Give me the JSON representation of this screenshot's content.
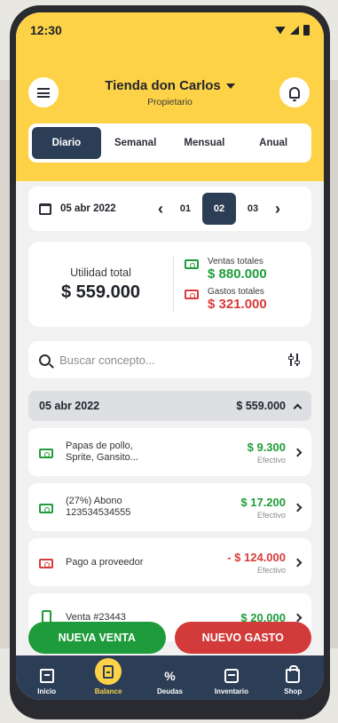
{
  "status": {
    "time": "12:30"
  },
  "header": {
    "store_name": "Tienda don Carlos",
    "role": "Propietario"
  },
  "tabs": [
    {
      "label": "Diario",
      "active": true
    },
    {
      "label": "Semanal",
      "active": false
    },
    {
      "label": "Mensual",
      "active": false
    },
    {
      "label": "Anual",
      "active": false
    }
  ],
  "date_picker": {
    "date": "05 abr 2022",
    "days": [
      "01",
      "02",
      "03"
    ],
    "selected_day": "02"
  },
  "summary": {
    "profit_label": "Utilidad total",
    "profit_value": "$ 559.000",
    "sales_label": "Ventas totales",
    "sales_value": "$ 880.000",
    "expenses_label": "Gastos totales",
    "expenses_value": "$ 321.000"
  },
  "search": {
    "placeholder": "Buscar concepto..."
  },
  "group": {
    "date": "05 abr 2022",
    "total": "$ 559.000"
  },
  "transactions": [
    {
      "desc_line1": "Papas de pollo,",
      "desc_line2": "Sprite, Gansito...",
      "amount": "$ 9.300",
      "method": "Efectivo",
      "type": "income"
    },
    {
      "desc_line1": "(27%) Abono",
      "desc_line2": "123534534555",
      "amount": "$ 17.200",
      "method": "Efectivo",
      "type": "income"
    },
    {
      "desc_line1": "Pago a proveedor",
      "desc_line2": "",
      "amount": "- $ 124.000",
      "method": "Efectivo",
      "type": "expense"
    },
    {
      "desc_line1": "Venta #23443",
      "desc_line2": "",
      "amount": "$ 20.000",
      "method": "",
      "type": "income"
    }
  ],
  "actions": {
    "new_sale": "NUEVA VENTA",
    "new_expense": "NUEVO GASTO"
  },
  "nav": [
    {
      "label": "Inicio",
      "icon": "home-icon"
    },
    {
      "label": "Balance",
      "icon": "balance-icon"
    },
    {
      "label": "Deudas",
      "icon": "percent-icon"
    },
    {
      "label": "Inventario",
      "icon": "inventory-icon"
    },
    {
      "label": "Shop",
      "icon": "shop-icon"
    }
  ],
  "colors": {
    "yellow": "#fdd247",
    "navy": "#2c3e56",
    "green": "#1e9b3b",
    "red": "#d33a3a"
  }
}
